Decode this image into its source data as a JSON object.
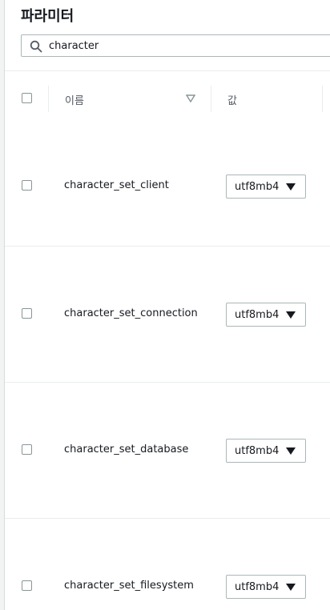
{
  "page": {
    "title": "파라미터"
  },
  "search": {
    "value": "character",
    "icon": "search-icon"
  },
  "table": {
    "columns": {
      "name": "이름",
      "value": "값"
    },
    "rows": [
      {
        "name": "character_set_client",
        "value": "utf8mb4"
      },
      {
        "name": "character_set_connection",
        "value": "utf8mb4"
      },
      {
        "name": "character_set_database",
        "value": "utf8mb4"
      },
      {
        "name": "character_set_filesystem",
        "value": "utf8mb4"
      }
    ]
  },
  "colors": {
    "border": "#aab7b8",
    "divider": "#eaeded",
    "text": "#16191f",
    "muted": "#545b64"
  }
}
